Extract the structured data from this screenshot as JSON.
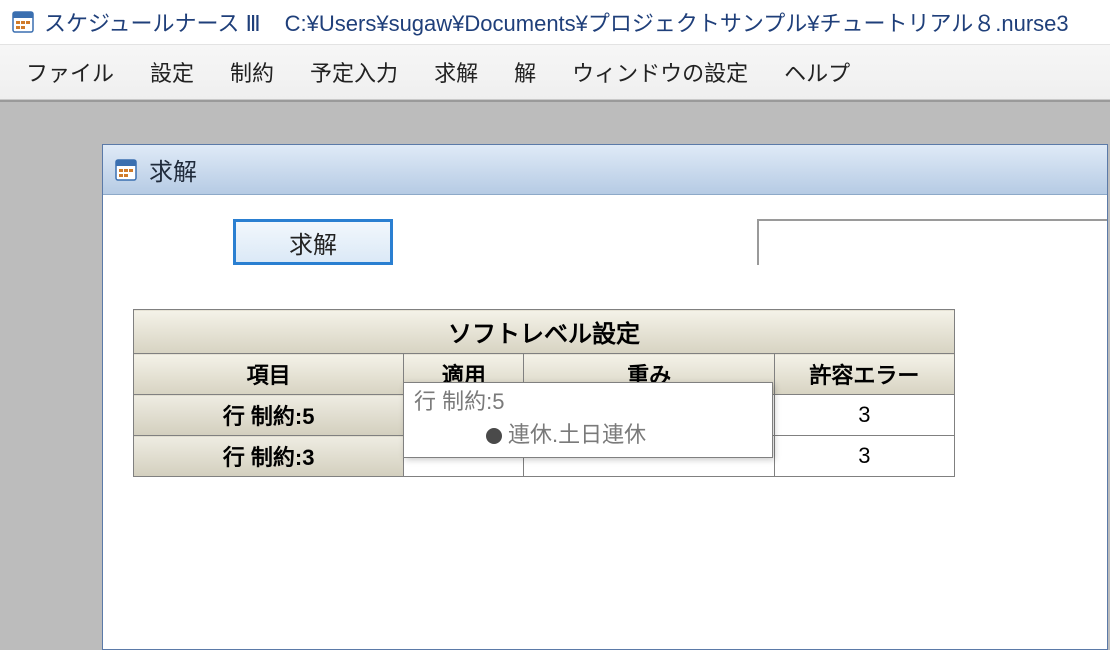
{
  "window": {
    "app_title": "スケジュールナース Ⅲ",
    "file_path": "C:¥Users¥sugaw¥Documents¥プロジェクトサンプル¥チュートリアル８.nurse3"
  },
  "menubar": {
    "items": [
      "ファイル",
      "設定",
      "制約",
      "予定入力",
      "求解",
      "解",
      "ウィンドウの設定",
      "ヘルプ"
    ]
  },
  "child_window": {
    "title": "求解",
    "solve_button": "求解"
  },
  "table": {
    "caption": "ソフトレベル設定",
    "headers": {
      "item": "項目",
      "apply": "適用",
      "weight": "重み",
      "allow_error": "許容エラー"
    },
    "rows": [
      {
        "item": "行 制約:5",
        "apply": "",
        "weight": "",
        "allow_error": "3"
      },
      {
        "item": "行 制約:3",
        "apply": "",
        "weight": "",
        "allow_error": "3"
      }
    ]
  },
  "tooltip": {
    "line1": "行 制約:5",
    "line2": "連休.土日連休"
  }
}
